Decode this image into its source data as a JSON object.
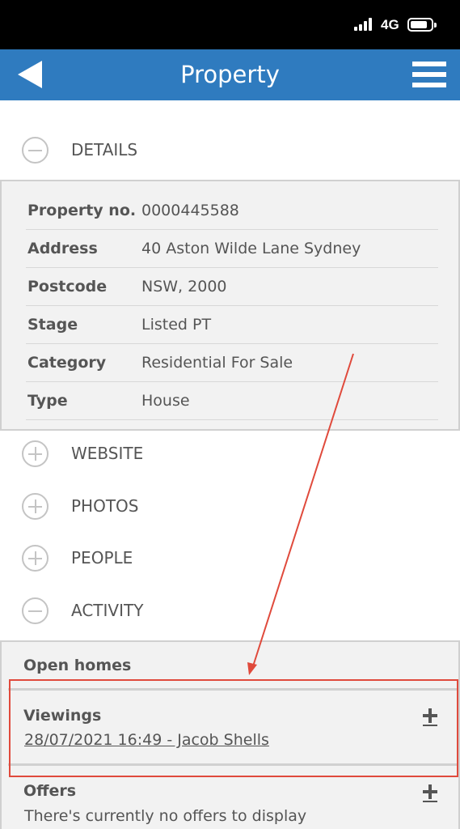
{
  "status_bar": {
    "network": "4G",
    "icons": [
      "signal-icon",
      "battery-icon"
    ]
  },
  "header": {
    "title": "Property",
    "back_icon": "back-arrow-icon",
    "menu_icon": "hamburger-menu-icon",
    "bg_color": "#2f7bbf"
  },
  "sections": {
    "details": {
      "label": "DETAILS",
      "state": "expanded",
      "icon": "minus-circle-icon"
    },
    "website": {
      "label": "WEBSITE",
      "state": "collapsed",
      "icon": "plus-circle-icon"
    },
    "photos": {
      "label": "PHOTOS",
      "state": "collapsed",
      "icon": "plus-circle-icon"
    },
    "people": {
      "label": "PEOPLE",
      "state": "collapsed",
      "icon": "plus-circle-icon"
    },
    "activity": {
      "label": "ACTIVITY",
      "state": "expanded",
      "icon": "minus-circle-icon"
    }
  },
  "details": [
    {
      "key": "Property no.",
      "value": "0000445588"
    },
    {
      "key": "Address",
      "value": "40 Aston Wilde Lane Sydney"
    },
    {
      "key": "Postcode",
      "value": "NSW, 2000"
    },
    {
      "key": "Stage",
      "value": "Listed PT"
    },
    {
      "key": "Category",
      "value": "Residential For Sale"
    },
    {
      "key": "Type",
      "value": "House"
    }
  ],
  "activity": {
    "open_homes": {
      "title": "Open homes"
    },
    "viewings": {
      "title": "Viewings",
      "add_icon": "plus-icon",
      "entries": [
        "28/07/2021 16:49 - Jacob Shells"
      ]
    },
    "offers": {
      "title": "Offers",
      "add_icon": "plus-icon",
      "empty_text": "There's currently no offers to display"
    }
  },
  "annotation": {
    "color": "#e04a3c",
    "type": "arrow-and-highlight-box"
  }
}
